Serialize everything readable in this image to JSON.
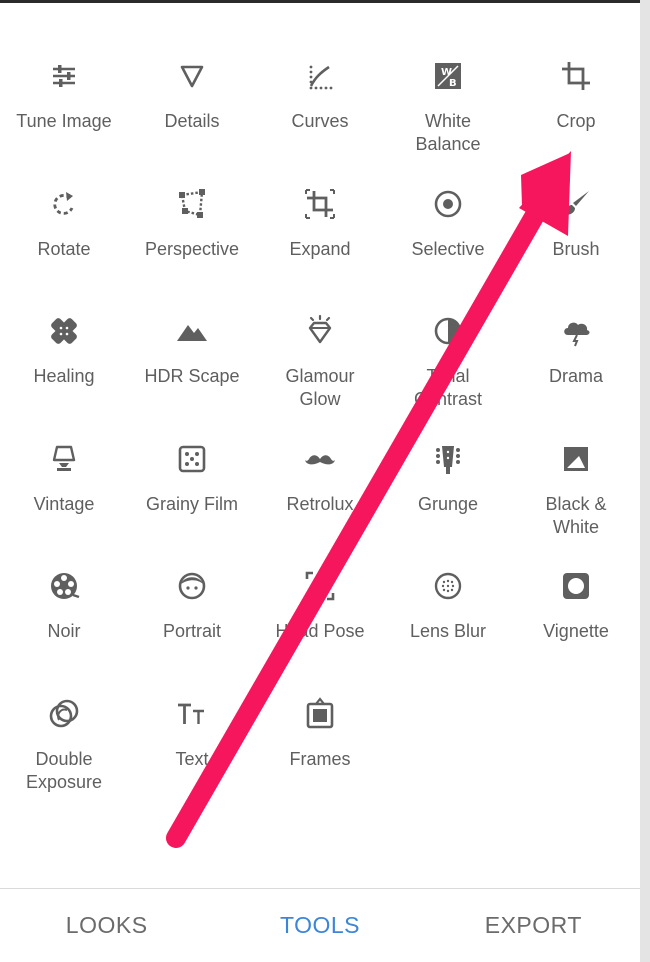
{
  "tools": [
    {
      "label": "Tune Image",
      "icon": "sliders-icon"
    },
    {
      "label": "Details",
      "icon": "triangle-down-icon"
    },
    {
      "label": "Curves",
      "icon": "curves-icon"
    },
    {
      "label": "White\nBalance",
      "icon": "white-balance-icon"
    },
    {
      "label": "Crop",
      "icon": "crop-icon"
    },
    {
      "label": "Rotate",
      "icon": "rotate-icon"
    },
    {
      "label": "Perspective",
      "icon": "perspective-icon"
    },
    {
      "label": "Expand",
      "icon": "expand-icon"
    },
    {
      "label": "Selective",
      "icon": "target-icon"
    },
    {
      "label": "Brush",
      "icon": "brush-icon"
    },
    {
      "label": "Healing",
      "icon": "bandage-icon"
    },
    {
      "label": "HDR Scape",
      "icon": "mountains-icon"
    },
    {
      "label": "Glamour\nGlow",
      "icon": "diamond-icon"
    },
    {
      "label": "Tonal\nContrast",
      "icon": "tonal-contrast-icon"
    },
    {
      "label": "Drama",
      "icon": "storm-cloud-icon"
    },
    {
      "label": "Vintage",
      "icon": "lamp-icon"
    },
    {
      "label": "Grainy Film",
      "icon": "grain-dice-icon"
    },
    {
      "label": "Retrolux",
      "icon": "mustache-icon"
    },
    {
      "label": "Grunge",
      "icon": "guitar-head-icon"
    },
    {
      "label": "Black &\nWhite",
      "icon": "black-white-icon"
    },
    {
      "label": "Noir",
      "icon": "film-reel-icon"
    },
    {
      "label": "Portrait",
      "icon": "face-icon"
    },
    {
      "label": "Head Pose",
      "icon": "head-pose-icon"
    },
    {
      "label": "Lens Blur",
      "icon": "lens-blur-icon"
    },
    {
      "label": "Vignette",
      "icon": "vignette-icon"
    },
    {
      "label": "Double\nExposure",
      "icon": "double-exposure-icon"
    },
    {
      "label": "Text",
      "icon": "text-icon"
    },
    {
      "label": "Frames",
      "icon": "frame-icon"
    }
  ],
  "nav": {
    "looks": "LOOKS",
    "tools": "TOOLS",
    "export": "EXPORT",
    "active": "tools"
  },
  "colors": {
    "icon": "#5f5f5f",
    "label": "#5f5f5f",
    "active_tab": "#3b86d9",
    "inactive_tab": "#6b6b6b",
    "annotation_arrow": "#f5165e"
  }
}
